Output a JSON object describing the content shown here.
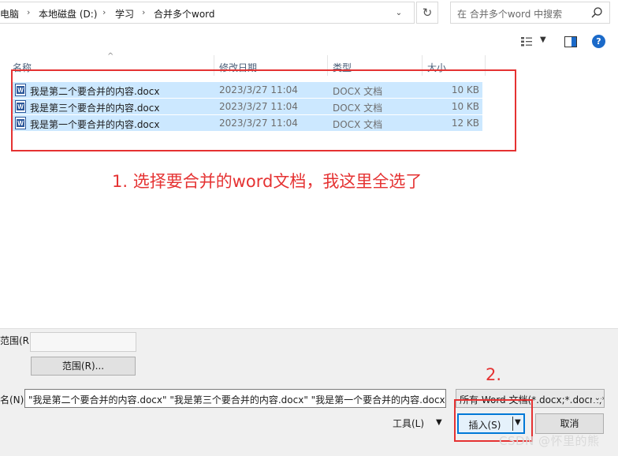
{
  "address_bar": {
    "crumbs": [
      "电脑",
      "本地磁盘 (D:)",
      "学习",
      "合并多个word"
    ]
  },
  "search": {
    "placeholder": "在 合并多个word 中搜索"
  },
  "columns": {
    "name": "名称",
    "date": "修改日期",
    "type": "类型",
    "size": "大小"
  },
  "files": [
    {
      "name": "我是第二个要合并的内容.docx",
      "date": "2023/3/27 11:04",
      "type": "DOCX 文档",
      "size": "10 KB"
    },
    {
      "name": "我是第三个要合并的内容.docx",
      "date": "2023/3/27 11:04",
      "type": "DOCX 文档",
      "size": "10 KB"
    },
    {
      "name": "我是第一个要合并的内容.docx",
      "date": "2023/3/27 11:04",
      "type": "DOCX 文档",
      "size": "12 KB"
    }
  ],
  "annotations": {
    "step1": "1.  选择要合并的word文档，我这里全选了",
    "step2": "2."
  },
  "bottom": {
    "range_label": "范围(R):",
    "range_button": "范围(R)...",
    "filename_label": "名(N):",
    "filename_value": "\"我是第二个要合并的内容.docx\" \"我是第三个要合并的内容.docx\" \"我是第一个要合并的内容.docx\"",
    "filter_value": "所有 Word 文档(*.docx;*.docm;*.dotx)",
    "tools_label": "工具(L)",
    "insert_label": "插入(S)",
    "cancel_label": "取消"
  },
  "watermark": "CSDN @怀里的熊"
}
